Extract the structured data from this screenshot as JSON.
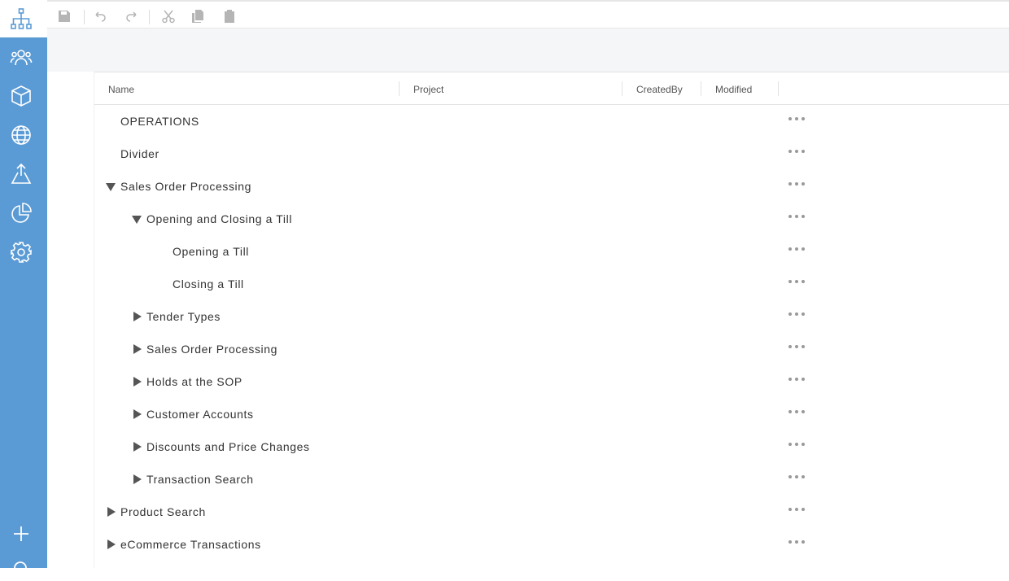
{
  "rail": {
    "icons": [
      "hierarchy-icon",
      "people-icon",
      "box-icon",
      "globe-icon",
      "publish-icon",
      "pie-chart-icon",
      "gear-icon"
    ],
    "bottom_icons": [
      "add-icon",
      "search-icon"
    ],
    "active_color": "#5b9bd5"
  },
  "toolbar": {
    "buttons": [
      "save-icon",
      "undo-icon",
      "redo-icon",
      "cut-icon",
      "copy-icon",
      "paste-icon"
    ]
  },
  "grid": {
    "columns": [
      "Name",
      "Project",
      "CreatedBy",
      "Modified"
    ],
    "rows": [
      {
        "label": "OPERATIONS",
        "state": "none"
      },
      {
        "label": "Divider",
        "state": "none"
      },
      {
        "label": "Sales Order Processing",
        "state": "expanded"
      },
      {
        "label": "Opening and Closing a Till",
        "state": "expanded"
      },
      {
        "label": "Opening a Till",
        "state": "none"
      },
      {
        "label": "Closing a Till",
        "state": "none"
      },
      {
        "label": "Tender Types",
        "state": "collapsed"
      },
      {
        "label": "Sales Order Processing",
        "state": "collapsed"
      },
      {
        "label": "Holds at the SOP",
        "state": "collapsed"
      },
      {
        "label": "Customer Accounts",
        "state": "collapsed"
      },
      {
        "label": "Discounts and Price Changes",
        "state": "collapsed"
      },
      {
        "label": "Transaction Search",
        "state": "collapsed"
      },
      {
        "label": "Product Search",
        "state": "collapsed"
      },
      {
        "label": "eCommerce Transactions",
        "state": "collapsed"
      }
    ]
  }
}
